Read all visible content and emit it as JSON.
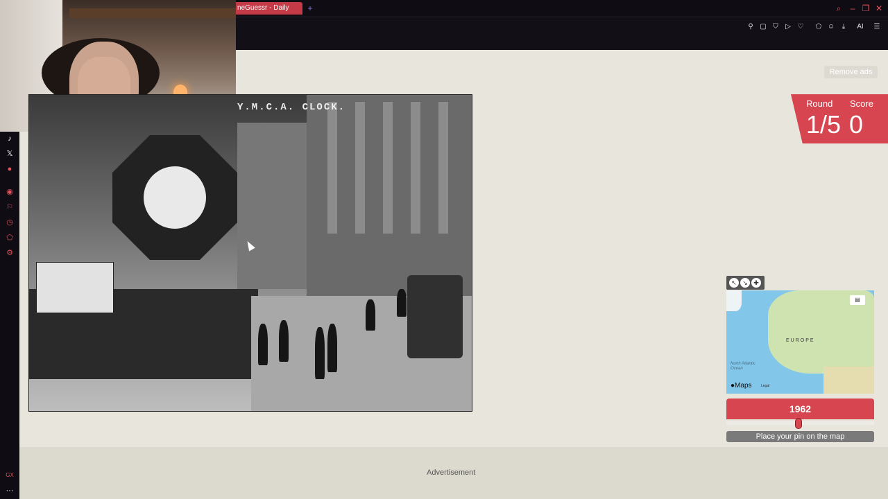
{
  "browser": {
    "tab_title": "neGuessr - Daily",
    "new_tab": "+",
    "toolbar_ai_label": "AI"
  },
  "sidebar": {
    "bottom_label": "GX",
    "more": "···"
  },
  "game": {
    "remove_ads": "Remove ads",
    "round_label": "Round",
    "round_value": "1/5",
    "score_label": "Score",
    "score_value": "0",
    "photo_caption": "Y.M.C.A. CLOCK.",
    "year": "1962",
    "place_pin_label": "Place your pin on the map",
    "slider_fraction": 0.49
  },
  "map": {
    "region_label": "EUROPE",
    "ocean_label": "North Atlantic Ocean",
    "brand": "Maps",
    "legal": "Legal"
  },
  "ad": {
    "label": "Advertisement"
  },
  "colors": {
    "accent": "#d64550",
    "background": "#e8e6dc"
  }
}
